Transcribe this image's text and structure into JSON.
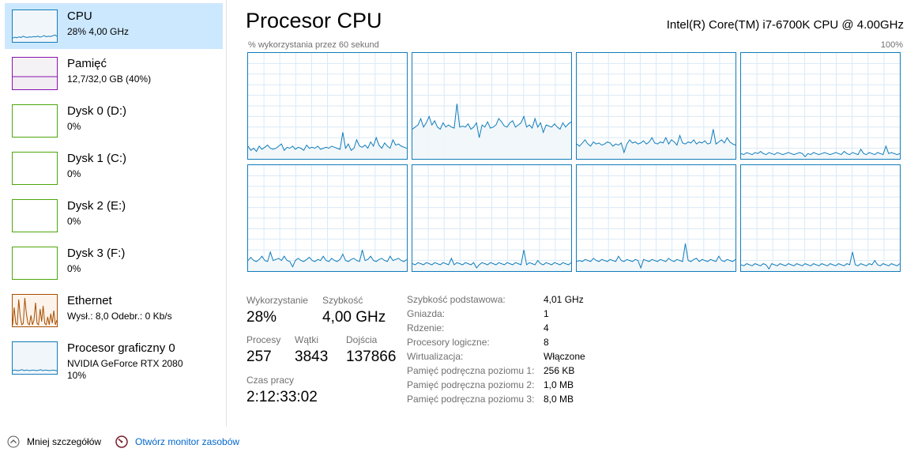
{
  "sidebar": {
    "items": [
      {
        "title": "CPU",
        "sub": "28% 4,00 GHz",
        "sub2": "",
        "color": "#117dbb",
        "fill": "#f1f6fa"
      },
      {
        "title": "Pamięć",
        "sub": "12,7/32,0 GB (40%)",
        "sub2": "",
        "color": "#8b12ae",
        "fill": "#f4f2f4"
      },
      {
        "title": "Dysk 0 (D:)",
        "sub": "0%",
        "sub2": "",
        "color": "#4da60c",
        "fill": "#ffffff"
      },
      {
        "title": "Dysk 1 (C:)",
        "sub": "0%",
        "sub2": "",
        "color": "#4da60c",
        "fill": "#ffffff"
      },
      {
        "title": "Dysk 2 (E:)",
        "sub": "0%",
        "sub2": "",
        "color": "#4da60c",
        "fill": "#ffffff"
      },
      {
        "title": "Dysk 3 (F:)",
        "sub": "0%",
        "sub2": "",
        "color": "#4da60c",
        "fill": "#ffffff"
      },
      {
        "title": "Ethernet",
        "sub": "Wysł.: 8,0  Odebr.: 0 Kb/s",
        "sub2": "",
        "color": "#a74f01",
        "fill": "#fcf3eb"
      },
      {
        "title": "Procesor graficzny 0",
        "sub": "NVIDIA GeForce RTX 2080",
        "sub2": "10%",
        "color": "#117dbb",
        "fill": "#f1f6fa"
      }
    ]
  },
  "main": {
    "title": "Procesor CPU",
    "cpu_model": "Intel(R) Core(TM) i7-6700K CPU @ 4.00GHz",
    "graph_label": "% wykorzystania przez 60 sekund",
    "graph_max": "100%",
    "accent_color": "#117dbb",
    "core_fill": "#f1f6fa",
    "cores": [
      {
        "name": "core-0",
        "levels": [
          0.12,
          0.08,
          0.1,
          0.07,
          0.12,
          0.09,
          0.11,
          0.13,
          0.1,
          0.09,
          0.1,
          0.12,
          0.14,
          0.08,
          0.11,
          0.1,
          0.12,
          0.09,
          0.11,
          0.1,
          0.08,
          0.13,
          0.1,
          0.11,
          0.1,
          0.12,
          0.09,
          0.1,
          0.11,
          0.1,
          0.12,
          0.11,
          0.1,
          0.09,
          0.25,
          0.1,
          0.14,
          0.08,
          0.1,
          0.18,
          0.12,
          0.11,
          0.13,
          0.1,
          0.16,
          0.12,
          0.2,
          0.13,
          0.1,
          0.15,
          0.12,
          0.1,
          0.18,
          0.13,
          0.14,
          0.12,
          0.11,
          0.1
        ]
      },
      {
        "name": "core-1",
        "levels": [
          0.28,
          0.3,
          0.32,
          0.38,
          0.3,
          0.34,
          0.4,
          0.32,
          0.36,
          0.3,
          0.28,
          0.34,
          0.3,
          0.32,
          0.3,
          0.29,
          0.52,
          0.3,
          0.31,
          0.3,
          0.33,
          0.28,
          0.3,
          0.34,
          0.2,
          0.32,
          0.3,
          0.35,
          0.29,
          0.3,
          0.32,
          0.38,
          0.35,
          0.31,
          0.3,
          0.34,
          0.36,
          0.3,
          0.32,
          0.34,
          0.4,
          0.3,
          0.32,
          0.29,
          0.38,
          0.3,
          0.34,
          0.25,
          0.32,
          0.31,
          0.3,
          0.33,
          0.3,
          0.28,
          0.34,
          0.3,
          0.33,
          0.35
        ]
      },
      {
        "name": "core-2",
        "levels": [
          0.14,
          0.12,
          0.15,
          0.18,
          0.14,
          0.12,
          0.16,
          0.14,
          0.15,
          0.13,
          0.14,
          0.16,
          0.15,
          0.12,
          0.14,
          0.13,
          0.15,
          0.06,
          0.14,
          0.18,
          0.15,
          0.16,
          0.14,
          0.15,
          0.17,
          0.14,
          0.16,
          0.2,
          0.15,
          0.14,
          0.16,
          0.15,
          0.2,
          0.14,
          0.18,
          0.16,
          0.13,
          0.22,
          0.15,
          0.14,
          0.16,
          0.15,
          0.18,
          0.14,
          0.16,
          0.15,
          0.17,
          0.14,
          0.15,
          0.28,
          0.14,
          0.16,
          0.18,
          0.15,
          0.2,
          0.16,
          0.14,
          0.13
        ]
      },
      {
        "name": "core-3",
        "levels": [
          0.05,
          0.04,
          0.06,
          0.05,
          0.04,
          0.06,
          0.05,
          0.07,
          0.05,
          0.04,
          0.06,
          0.05,
          0.04,
          0.06,
          0.05,
          0.04,
          0.05,
          0.06,
          0.05,
          0.04,
          0.05,
          0.06,
          0.05,
          0.02,
          0.05,
          0.04,
          0.06,
          0.05,
          0.04,
          0.05,
          0.06,
          0.05,
          0.04,
          0.05,
          0.06,
          0.05,
          0.04,
          0.07,
          0.05,
          0.04,
          0.06,
          0.05,
          0.04,
          0.09,
          0.05,
          0.04,
          0.06,
          0.05,
          0.04,
          0.06,
          0.05,
          0.04,
          0.12,
          0.05,
          0.06,
          0.05,
          0.04,
          0.05
        ]
      },
      {
        "name": "core-4",
        "levels": [
          0.1,
          0.13,
          0.1,
          0.09,
          0.11,
          0.14,
          0.1,
          0.09,
          0.18,
          0.1,
          0.11,
          0.12,
          0.1,
          0.14,
          0.1,
          0.09,
          0.04,
          0.1,
          0.12,
          0.1,
          0.09,
          0.11,
          0.13,
          0.1,
          0.09,
          0.11,
          0.1,
          0.14,
          0.1,
          0.09,
          0.12,
          0.1,
          0.09,
          0.11,
          0.16,
          0.1,
          0.09,
          0.11,
          0.12,
          0.1,
          0.09,
          0.2,
          0.1,
          0.11,
          0.14,
          0.1,
          0.09,
          0.11,
          0.12,
          0.1,
          0.09,
          0.14,
          0.1,
          0.11,
          0.12,
          0.1,
          0.09,
          0.11
        ]
      },
      {
        "name": "core-5",
        "levels": [
          0.07,
          0.06,
          0.08,
          0.07,
          0.06,
          0.08,
          0.07,
          0.06,
          0.08,
          0.07,
          0.06,
          0.08,
          0.07,
          0.06,
          0.12,
          0.06,
          0.08,
          0.07,
          0.06,
          0.08,
          0.07,
          0.06,
          0.08,
          0.03,
          0.06,
          0.08,
          0.07,
          0.06,
          0.08,
          0.07,
          0.06,
          0.08,
          0.07,
          0.06,
          0.08,
          0.07,
          0.06,
          0.08,
          0.07,
          0.06,
          0.2,
          0.06,
          0.08,
          0.07,
          0.06,
          0.1,
          0.07,
          0.06,
          0.08,
          0.07,
          0.06,
          0.08,
          0.07,
          0.06,
          0.08,
          0.07,
          0.06,
          0.08
        ]
      },
      {
        "name": "core-6",
        "levels": [
          0.09,
          0.1,
          0.09,
          0.11,
          0.1,
          0.09,
          0.12,
          0.1,
          0.09,
          0.11,
          0.1,
          0.09,
          0.11,
          0.1,
          0.09,
          0.14,
          0.1,
          0.09,
          0.11,
          0.1,
          0.09,
          0.11,
          0.1,
          0.03,
          0.11,
          0.1,
          0.09,
          0.11,
          0.1,
          0.09,
          0.11,
          0.1,
          0.09,
          0.12,
          0.1,
          0.09,
          0.11,
          0.1,
          0.09,
          0.26,
          0.1,
          0.09,
          0.11,
          0.12,
          0.09,
          0.11,
          0.1,
          0.09,
          0.11,
          0.1,
          0.09,
          0.14,
          0.1,
          0.09,
          0.11,
          0.1,
          0.09,
          0.11
        ]
      },
      {
        "name": "core-7",
        "levels": [
          0.06,
          0.05,
          0.07,
          0.06,
          0.05,
          0.07,
          0.06,
          0.05,
          0.07,
          0.06,
          0.02,
          0.07,
          0.06,
          0.05,
          0.07,
          0.06,
          0.05,
          0.07,
          0.06,
          0.05,
          0.07,
          0.06,
          0.05,
          0.07,
          0.06,
          0.05,
          0.07,
          0.06,
          0.05,
          0.07,
          0.06,
          0.05,
          0.07,
          0.06,
          0.05,
          0.07,
          0.06,
          0.05,
          0.07,
          0.06,
          0.18,
          0.06,
          0.05,
          0.07,
          0.06,
          0.05,
          0.07,
          0.06,
          0.1,
          0.06,
          0.05,
          0.07,
          0.06,
          0.05,
          0.07,
          0.06,
          0.05,
          0.07
        ]
      }
    ]
  },
  "stats": {
    "usage_label": "Wykorzystanie",
    "usage_value": "28%",
    "speed_label": "Szybkość",
    "speed_value": "4,00 GHz",
    "processes_label": "Procesy",
    "processes_value": "257",
    "threads_label": "Wątki",
    "threads_value": "3843",
    "handles_label": "Dojścia",
    "handles_value": "137866",
    "uptime_label": "Czas pracy",
    "uptime_value": "2:12:33:02"
  },
  "properties": [
    {
      "label": "Szybkość podstawowa:",
      "value": "4,01 GHz"
    },
    {
      "label": "Gniazda:",
      "value": "1"
    },
    {
      "label": "Rdzenie:",
      "value": "4"
    },
    {
      "label": "Procesory logiczne:",
      "value": "8"
    },
    {
      "label": "Wirtualizacja:",
      "value": "Włączone"
    },
    {
      "label": "Pamięć podręczna poziomu 1:",
      "value": "256 KB"
    },
    {
      "label": "Pamięć podręczna poziomu 2:",
      "value": "1,0 MB"
    },
    {
      "label": "Pamięć podręczna poziomu 3:",
      "value": "8,0 MB"
    }
  ],
  "footer": {
    "less_details": "Mniej szczegółów",
    "less_details_icon": "chevron-up-circle",
    "open_monitor": "Otwórz monitor zasobów",
    "open_monitor_icon": "resource-monitor",
    "link_color": "#0066cc"
  }
}
